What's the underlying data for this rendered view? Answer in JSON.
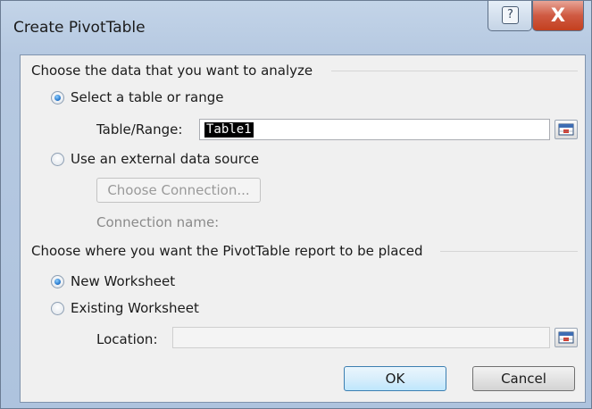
{
  "window": {
    "title": "Create PivotTable",
    "help_icon": "?",
    "close_icon": "X"
  },
  "analyze_section": {
    "heading": "Choose the data that you want to analyze",
    "option_table": {
      "label": "Select a table or range",
      "selected": true
    },
    "table_range": {
      "label": "Table/Range:",
      "value": "Table1",
      "range_icon": "collapse-dialog-icon"
    },
    "option_external": {
      "label": "Use an external data source",
      "selected": false
    },
    "choose_connection_label": "Choose Connection...",
    "connection_name_label": "Connection name:"
  },
  "placement_section": {
    "heading": "Choose where you want the PivotTable report to be placed",
    "option_new": {
      "label": "New Worksheet",
      "selected": true
    },
    "option_existing": {
      "label": "Existing Worksheet",
      "selected": false
    },
    "location": {
      "label": "Location:",
      "value": "",
      "range_icon": "collapse-dialog-icon"
    }
  },
  "buttons": {
    "ok": "OK",
    "cancel": "Cancel"
  },
  "colors": {
    "accent": "#1d6fc7",
    "close": "#c3401f",
    "selection": "#000000"
  }
}
